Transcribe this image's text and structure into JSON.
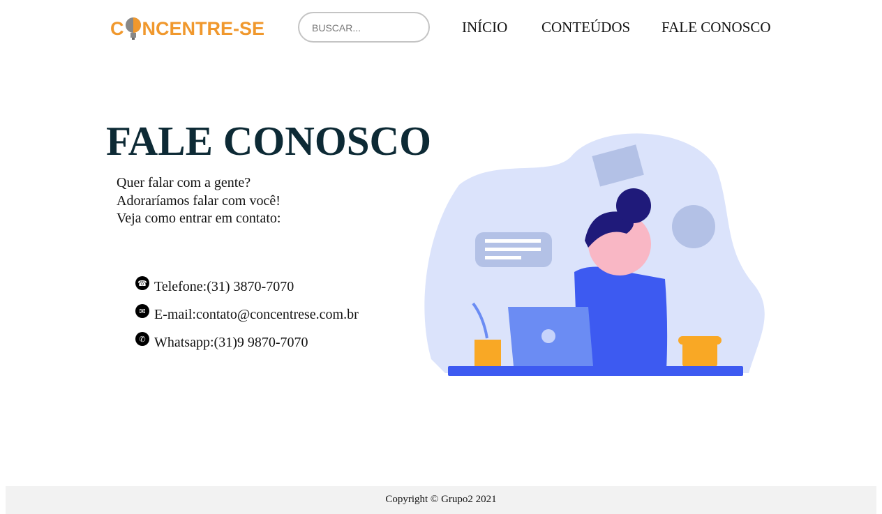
{
  "header": {
    "logo_text": "CONCENTRE-SE",
    "search_placeholder": "BUSCAR...",
    "nav": [
      "INÍCIO",
      "CONTEÚDOS",
      "FALE CONOSCO"
    ]
  },
  "main": {
    "title": "FALE CONOSCO",
    "intro": [
      "Quer falar com a gente?",
      "Adoraríamos falar com você!",
      "Veja como entrar em contato:"
    ],
    "contacts": [
      {
        "icon": "phone-icon",
        "label": "Telefone:",
        "value": "(31) 3870-7070"
      },
      {
        "icon": "mail-icon",
        "label": "E-mail:",
        "value": "contato@concentrese.com.br"
      },
      {
        "icon": "whatsapp-icon",
        "label": "Whatsapp:",
        "value": "(31)9 9870-7070"
      }
    ]
  },
  "footer": {
    "copyright": "Copyright © Grupo2 2021"
  },
  "colors": {
    "brand": "#f0982d",
    "title": "#0d2a35",
    "illustration_blue": "#3d5af1"
  }
}
